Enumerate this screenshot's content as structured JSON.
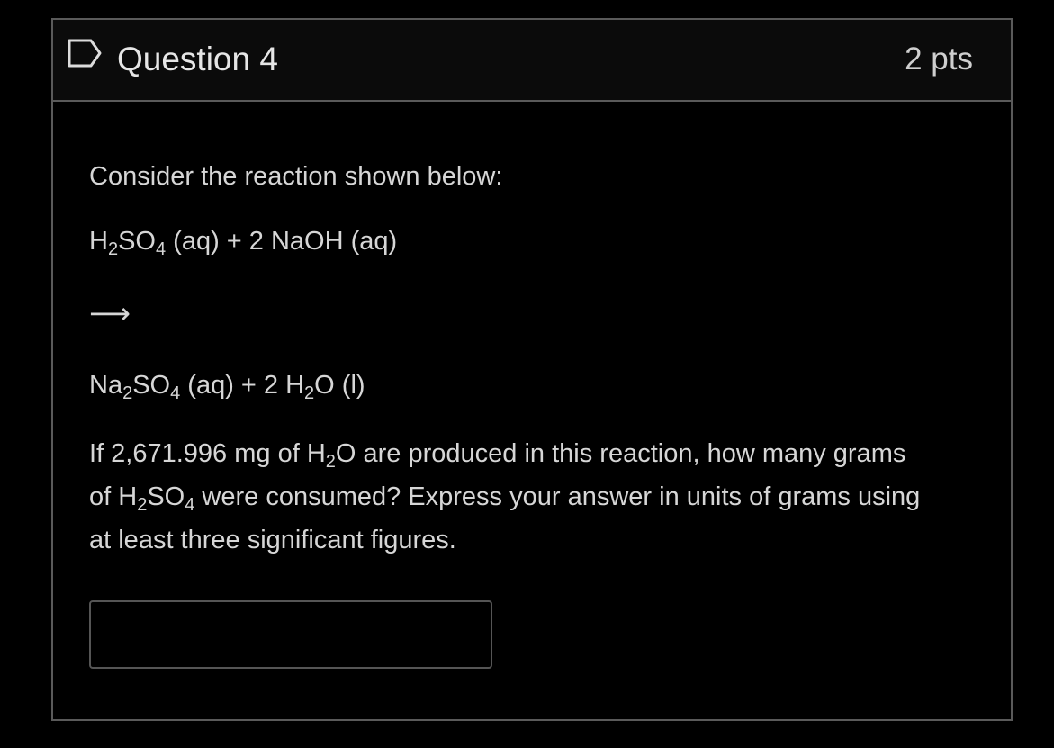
{
  "question": {
    "title": "Question 4",
    "points": "2 pts",
    "flag_icon": "bookmark-flag-icon"
  },
  "body": {
    "prompt": "Consider the reaction shown below:",
    "reactants": {
      "a1": "H",
      "a1_sub": "2",
      "a2": "SO",
      "a2_sub": "4",
      "rest": " (aq) + 2 NaOH (aq)"
    },
    "arrow": "⟶",
    "products": {
      "p1": "Na",
      "p1_sub": "2",
      "p2": "SO",
      "p2_sub": "4",
      "p3": " (aq) +  2 H",
      "p3_sub": "2",
      "p4": "O (l)"
    },
    "paragraph": {
      "l1_a": "If 2,671.996 mg of H",
      "l1_sub": "2",
      "l1_b": "O are produced in this reaction, how many grams",
      "l2_a": "of H",
      "l2_sub1": "2",
      "l2_b": "SO",
      "l2_sub2": "4",
      "l2_c": " were consumed? Express your answer in units of grams using",
      "l3": "at least three significant figures."
    }
  },
  "answer": {
    "value": "",
    "placeholder": ""
  },
  "colors": {
    "background": "#000000",
    "header_background": "#0b0b0b",
    "border": "#5a5a5a",
    "text": "#d6d6d6"
  }
}
